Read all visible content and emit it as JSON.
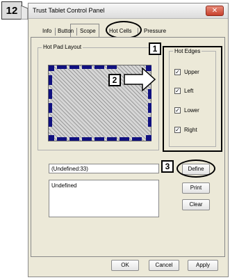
{
  "step_number": "12",
  "window": {
    "title": "Trust Tablet Control Panel",
    "close_glyph": "✕"
  },
  "tabs": [
    {
      "label": "Info"
    },
    {
      "label": "Button"
    },
    {
      "label": "Scope"
    },
    {
      "label": "Hot Cells",
      "active": true
    },
    {
      "label": "Pressure"
    }
  ],
  "hot_pad": {
    "group_label": "Hot Pad Layout"
  },
  "hot_edges": {
    "group_label": "Hot Edges",
    "items": [
      {
        "label": "Upper",
        "checked": true
      },
      {
        "label": "Left",
        "checked": true
      },
      {
        "label": "Lower",
        "checked": true
      },
      {
        "label": "Right",
        "checked": true
      }
    ]
  },
  "callouts": [
    "1",
    "2",
    "3"
  ],
  "cell_field": {
    "value": "(Undefined:33)"
  },
  "cell_list": {
    "items": [
      "Undefined"
    ]
  },
  "buttons": {
    "define": "Define",
    "print": "Print",
    "clear": "Clear",
    "ok": "OK",
    "cancel": "Cancel",
    "apply": "Apply"
  },
  "colors": {
    "pad_segment": "#101080",
    "dialog_bg": "#ece9d8"
  },
  "icons": [
    "right-arrow-icon",
    "close-icon",
    "checkbox-check-icon"
  ]
}
